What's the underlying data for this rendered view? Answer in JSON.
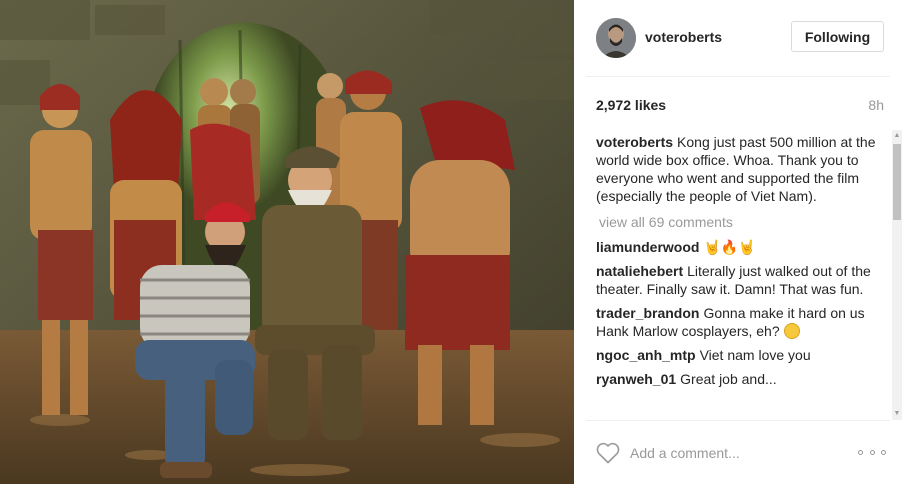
{
  "post": {
    "image_alt": "Cast photo in jungle ruins",
    "author": "voteroberts",
    "follow_label": "Following",
    "likes": "2,972 likes",
    "time_ago": "8h"
  },
  "caption": {
    "author": "voteroberts",
    "text": "Kong just past 500 million at the world wide box office. Whoa. Thank you to everyone who went and supported the film (especially the people of Viet Nam)."
  },
  "view_all_label": "view all 69 comments",
  "comments": [
    {
      "author": "liamunderwood",
      "text": "🤘🔥🤘"
    },
    {
      "author": "nataliehebert",
      "text": "Literally just walked out of the theater. Finally saw it. Damn! That was fun."
    },
    {
      "author": "trader_brandon",
      "text": "Gonna make it hard on us Hank Marlow cosplayers, eh?"
    },
    {
      "author": "ngoc_anh_mtp",
      "text": "Viet nam love you"
    },
    {
      "author": "ryanweh_01",
      "text": "Great job and..."
    }
  ],
  "add_comment_placeholder": "Add a comment...",
  "colors": {
    "text": "#262626",
    "muted": "#999999",
    "border": "#dbdbdb"
  },
  "icons": {
    "like": "heart-outline-icon",
    "more": "more-options-icon"
  }
}
